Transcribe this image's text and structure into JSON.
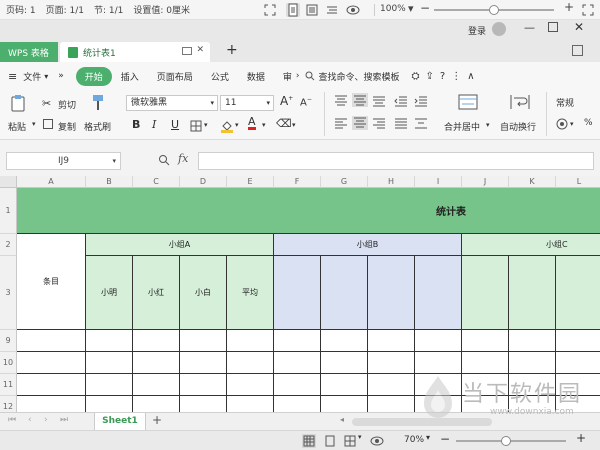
{
  "status_top": {
    "page_code": "页码: 1",
    "pages": "页面: 1/1",
    "section": "节: 1/1",
    "setting": "设置值: 0厘米",
    "zoom": "100%",
    "zoom_fraction": 0.5
  },
  "tabs": {
    "app_tab": "WPS 表格",
    "doc_tab": "统计表1",
    "login_label": "登录"
  },
  "menu": {
    "file": "文件",
    "items": [
      "开始",
      "插入",
      "页面布局",
      "公式",
      "数据",
      "审"
    ],
    "search_placeholder": "查找命令、搜索模板"
  },
  "ribbon": {
    "paste": "粘贴",
    "cut": "剪切",
    "copy": "复制",
    "format_painter": "格式刷",
    "font_name": "微软雅黑",
    "font_size": "11",
    "bold": "B",
    "italic": "I",
    "underline": "U",
    "merge_center": "合并居中",
    "wrap_text": "自动换行",
    "number_format": "常规"
  },
  "formula": {
    "cell_ref": "IJ9",
    "fx": "fx",
    "value": ""
  },
  "grid": {
    "columns": [
      "A",
      "B",
      "C",
      "D",
      "E",
      "F",
      "G",
      "H",
      "I",
      "J",
      "K",
      "L"
    ],
    "rows": [
      "1",
      "2",
      "3",
      "9",
      "10",
      "11",
      "12"
    ],
    "title": "统计表",
    "row_label": "条目",
    "group_a": "小组A",
    "group_b": "小组B",
    "group_c": "小组C",
    "members": [
      "小明",
      "小红",
      "小白",
      "平均"
    ]
  },
  "sheets": {
    "active": "Sheet1",
    "add": "+"
  },
  "status_bottom": {
    "zoom": "70%",
    "zoom_fraction": 0.45
  },
  "watermark": {
    "brand": "当下软件园",
    "url": "www.downxia.com"
  },
  "colors": {
    "accent": "#4caf6e",
    "title_fill": "#77c48a",
    "group_fill": "#d5efd9",
    "group_b_fill": "#d9e1f2"
  }
}
